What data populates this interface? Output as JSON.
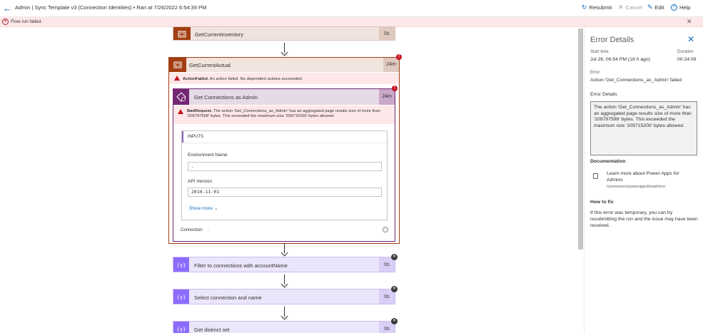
{
  "header": {
    "title": "Admin | Sync Template v3 (Connection Identities) • Ran at 7/26/2022 6:54:39 PM",
    "resubmit_label": "Resubmit",
    "cancel_label": "Cancel",
    "edit_label": "Edit",
    "help_label": "Help"
  },
  "error_bar": {
    "message": "Flow run failed."
  },
  "flow": {
    "actions": [
      {
        "name": "GetCurrentInventory",
        "duration": "0s"
      },
      {
        "name": "GetCurrentActual",
        "duration": "24m",
        "warning_title": "ActionFailed.",
        "warning_text": " An action failed. No dependent actions succeeded."
      },
      {
        "name": "Get Connections as Admin",
        "duration": "24m",
        "warning_title": "BadRequest.",
        "warning_text": " The action 'Get_Connections_as_Admin' has an aggregated page results size of more than '209797598' bytes. This exceeded the maximum size '209715200' bytes allowed."
      },
      {
        "name": "Filter to connections with accountName",
        "duration": "0s"
      },
      {
        "name": "Select connection and name",
        "duration": "0s"
      },
      {
        "name": "Get distinct set",
        "duration": "0s"
      }
    ],
    "inputs": {
      "heading": "INPUTS",
      "env_label": "Environment Name",
      "env_value": ".",
      "api_label": "API Version",
      "api_value": "2016-11-01",
      "show_more": "Show more",
      "connection_label": "Connection:",
      "connection_value": ":"
    }
  },
  "panel": {
    "title": "Error Details",
    "start_time_label": "Start time",
    "start_time_value": "Jul 26, 06:54 PM (18 h ago)",
    "duration_label": "Duration",
    "duration_value": "00:24:09",
    "error_label": "Error",
    "error_value": "Action 'Get_Connections_as_Admin' failed",
    "details_heading": "Error Details",
    "details_text": "The action 'Get_Connections_as_Admin' has an aggregated page results size of more than '209797598' bytes. This exceeded the maximum size '209715200' bytes allowed.",
    "doc_heading": "Documentation",
    "doc_link": "Learn more about Power Apps for Admins",
    "doc_path": "/connectors/powerappsforadmins/",
    "fix_heading": "How to fix",
    "fix_text": "If this error was temporary, you can try resubmitting the run and the issue may have been resolved."
  },
  "colors": {
    "accent": "#0f6cbd",
    "error": "#c50f1f",
    "error_bg": "#fde7e9",
    "scope_brown": "#a33e13",
    "scope_bg": "#f1e3dd",
    "admin_purple": "#742774",
    "data_ops_purple": "#8c6cff",
    "data_ops_bg": "#ece6fb"
  }
}
